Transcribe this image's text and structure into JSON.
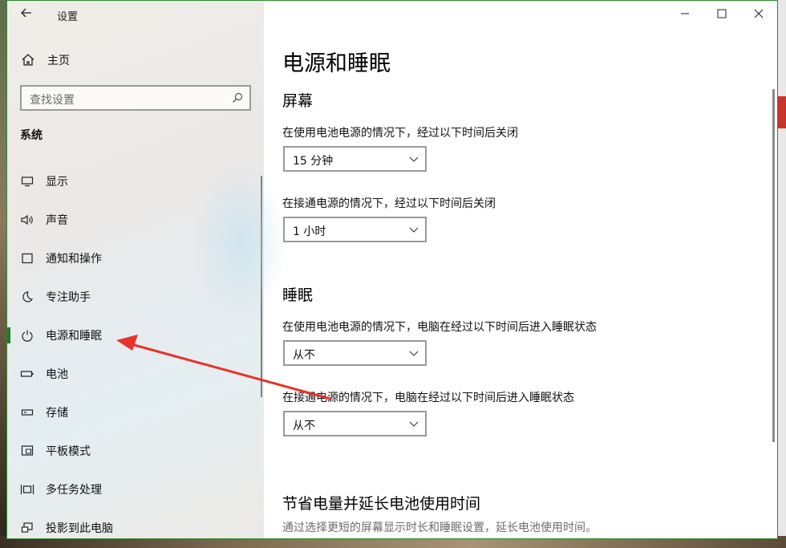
{
  "window": {
    "title": "设置",
    "controls": {
      "minimize": "minimize-icon",
      "maximize": "maximize-icon",
      "close": "close-icon"
    }
  },
  "sidebar": {
    "home_label": "主页",
    "search_placeholder": "查找设置",
    "section_title": "系统",
    "items": [
      {
        "label": "显示",
        "icon": "display-icon"
      },
      {
        "label": "声音",
        "icon": "speaker-icon"
      },
      {
        "label": "通知和操作",
        "icon": "notification-icon"
      },
      {
        "label": "专注助手",
        "icon": "moon-icon"
      },
      {
        "label": "电源和睡眠",
        "icon": "power-icon",
        "active": true
      },
      {
        "label": "电池",
        "icon": "battery-icon"
      },
      {
        "label": "存储",
        "icon": "storage-icon"
      },
      {
        "label": "平板模式",
        "icon": "tablet-icon"
      },
      {
        "label": "多任务处理",
        "icon": "multitask-icon"
      },
      {
        "label": "投影到此电脑",
        "icon": "project-icon"
      }
    ]
  },
  "main": {
    "title": "电源和睡眠",
    "screen": {
      "heading": "屏幕",
      "battery_label": "在使用电池电源的情况下，经过以下时间后关闭",
      "battery_value": "15 分钟",
      "plugged_label": "在接通电源的情况下，经过以下时间后关闭",
      "plugged_value": "1 小时"
    },
    "sleep": {
      "heading": "睡眠",
      "battery_label": "在使用电池电源的情况下，电脑在经过以下时间后进入睡眠状态",
      "battery_value": "从不",
      "plugged_label": "在接通电源的情况下，电脑在经过以下时间后进入睡眠状态",
      "plugged_value": "从不"
    },
    "save": {
      "heading": "节省电量并延长电池使用时间",
      "description": "通过选择更短的屏幕显示时长和睡眠设置，延长电池使用时间。"
    }
  },
  "colors": {
    "accent": "#1c7d2c",
    "annotation": "#e8332a"
  }
}
